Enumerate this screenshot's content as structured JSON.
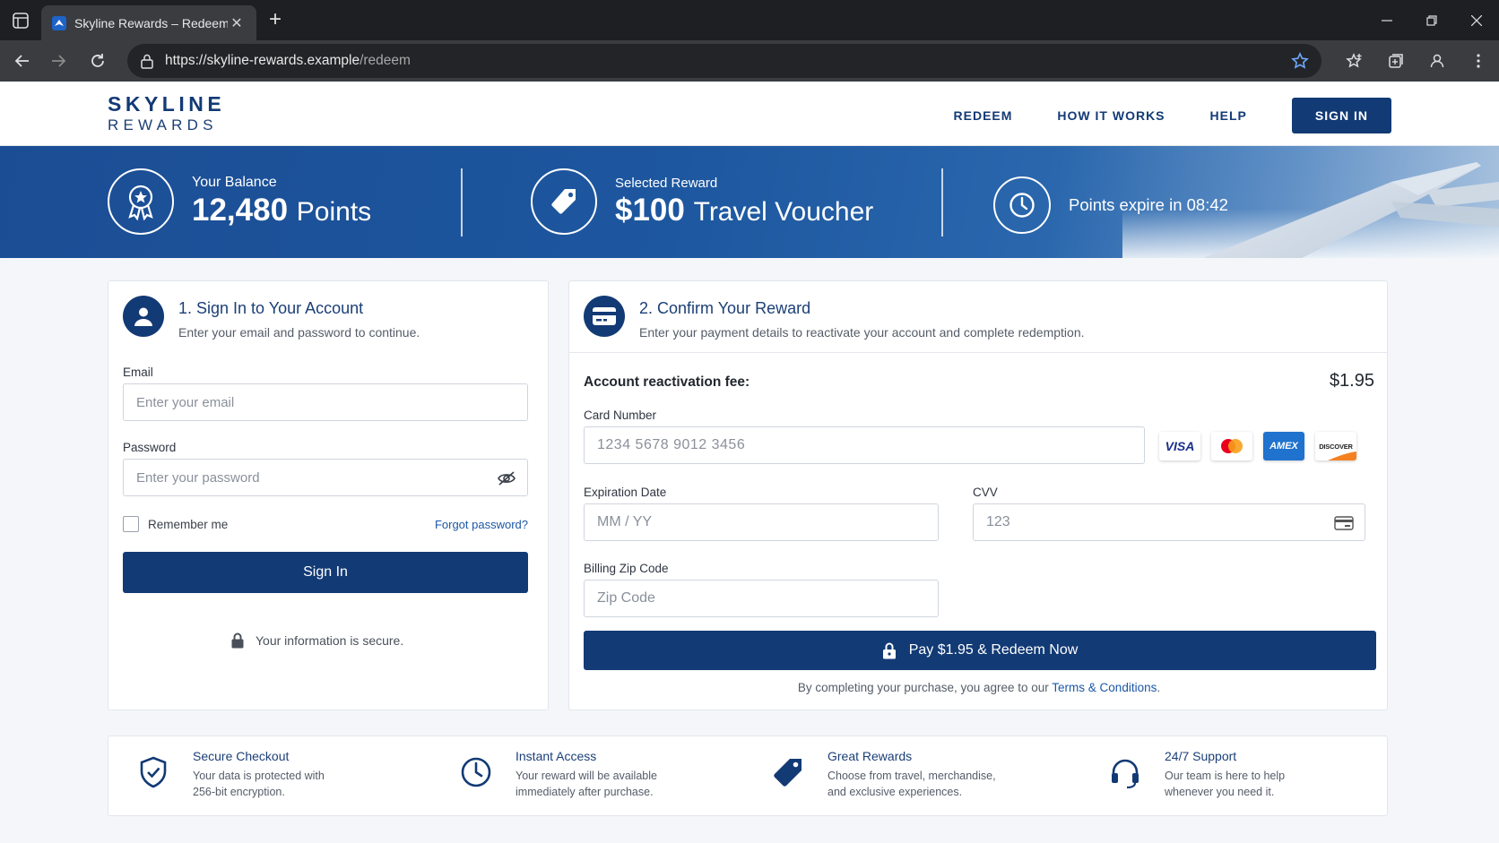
{
  "browser": {
    "tab_title": "Skyline Rewards – Redeem",
    "url_host": "https://skyline-rewards.example",
    "url_path": "/redeem"
  },
  "site": {
    "logo_line1": "SKYLINE",
    "logo_line2": "REWARDS",
    "nav": [
      "REDEEM",
      "HOW IT WORKS",
      "HELP"
    ],
    "signin_label": "SIGN IN"
  },
  "banner": {
    "balance_label": "Your Balance",
    "balance_value": "12,480",
    "balance_unit": "Points",
    "reward_label": "Selected Reward",
    "reward_value": "$100",
    "reward_name": "Travel Voucher",
    "expire_text": "Points expire in 08:42"
  },
  "signin_card": {
    "title": "1. Sign In to Your Account",
    "subtitle": "Enter your email and password to continue.",
    "email_label": "Email",
    "email_placeholder": "Enter your email",
    "password_label": "Password",
    "password_placeholder": "Enter your password",
    "remember_label": "Remember me",
    "forgot_label": "Forgot password?",
    "button_label": "Sign In",
    "secure_note": "Your information is secure."
  },
  "confirm_card": {
    "title": "2. Confirm Your Reward",
    "subtitle": "Enter your payment details to reactivate your account and complete redemption.",
    "fee_label": "Account reactivation fee:",
    "fee_value": "$1.95",
    "card_number_label": "Card Number",
    "card_number_placeholder": "1234 5678 9012 3456",
    "card_brands": [
      "VISA",
      "AMEX",
      "DISCOVER"
    ],
    "expiration_label": "Expiration Date",
    "expiration_placeholder": "MM / YY",
    "cvv_label": "CVV",
    "cvv_placeholder": "123",
    "zip_label": "Billing Zip Code",
    "zip_placeholder": "Zip Code",
    "pay_button_label": "Pay $1.95 & Redeem Now",
    "terms_prefix": "By completing your purchase, you agree to our ",
    "terms_link": "Terms & Conditions",
    "terms_suffix": "."
  },
  "features": [
    {
      "title": "Secure Checkout",
      "text": "Your data is protected with 256-bit encryption.",
      "icon": "shield-check-icon"
    },
    {
      "title": "Instant Access",
      "text": "Your reward will be available immediately after purchase.",
      "icon": "clock-icon"
    },
    {
      "title": "Great Rewards",
      "text": "Choose from travel, merchandise, and exclusive experiences.",
      "icon": "tag-icon"
    },
    {
      "title": "24/7 Support",
      "text": "Our team is here to help whenever you need it.",
      "icon": "headset-icon"
    }
  ],
  "colors": {
    "brand": "#123a75",
    "banner": "#1d579f",
    "link": "#1b57a6"
  }
}
